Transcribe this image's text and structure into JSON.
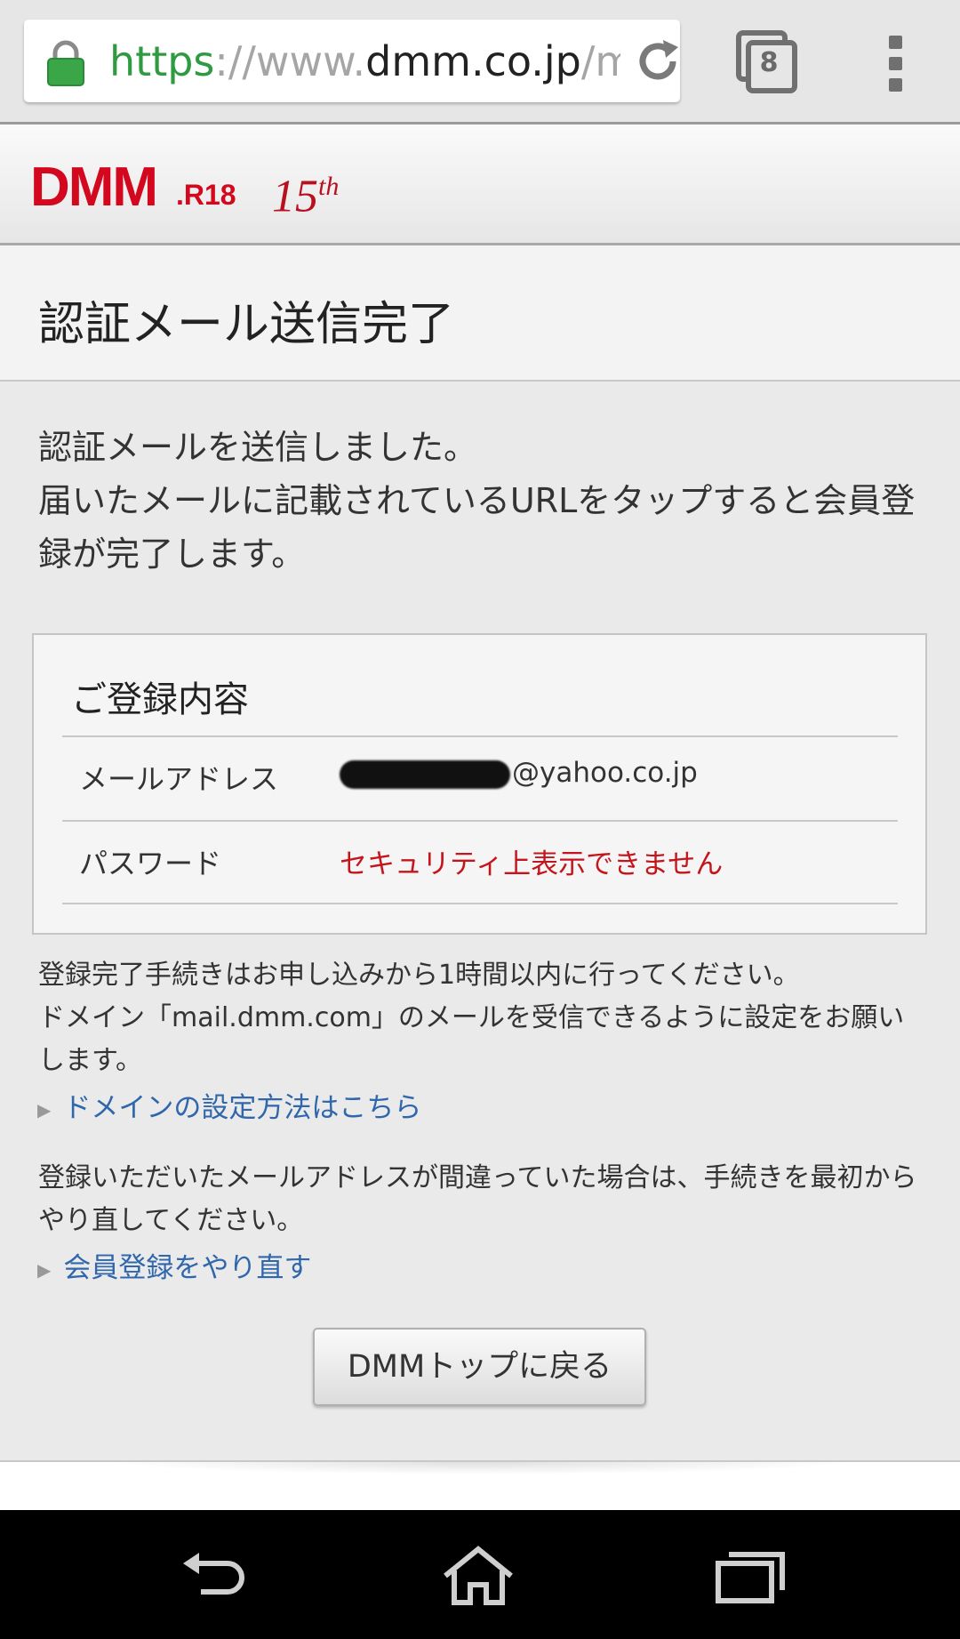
{
  "browser": {
    "url_scheme": "https",
    "url_sep1": "://",
    "url_www": "www.",
    "url_host": "dmm.co.jp",
    "url_path": "/my",
    "tab_count": "8",
    "icons": [
      "lock-icon",
      "reload-icon",
      "tabs-icon",
      "overflow-menu-icon"
    ]
  },
  "header": {
    "logo_dmm": "DMM",
    "logo_r18": ".R18",
    "logo_15": "15",
    "logo_th": "th"
  },
  "page": {
    "title": "認証メール送信完了",
    "intro_line1": "認証メールを送信しました。",
    "intro_line2": "届いたメールに記載されているURLをタップすると会員登録が完了します。"
  },
  "registration": {
    "heading": "ご登録内容",
    "email_label": "メールアドレス",
    "email_domain": "@yahoo.co.jp",
    "password_label": "パスワード",
    "password_value": "セキュリティ上表示できません",
    "warning_color": "#c4141c"
  },
  "notes": {
    "note1": "登録完了手続きはお申し込みから1時間以内に行ってください。",
    "note2": "ドメイン「mail.dmm.com」のメールを受信できるように設定をお願いします。",
    "domain_link": "ドメインの設定方法はこちら",
    "note3": "登録いただいたメールアドレスが間違っていた場合は、手続きを最初からやり直してください。",
    "redo_link": "会員登録をやり直す",
    "link_color": "#3066ab"
  },
  "actions": {
    "top_button": "DMMトップに戻る"
  },
  "system_nav": {
    "icons": [
      "back-icon",
      "home-icon",
      "recent-apps-icon"
    ]
  }
}
